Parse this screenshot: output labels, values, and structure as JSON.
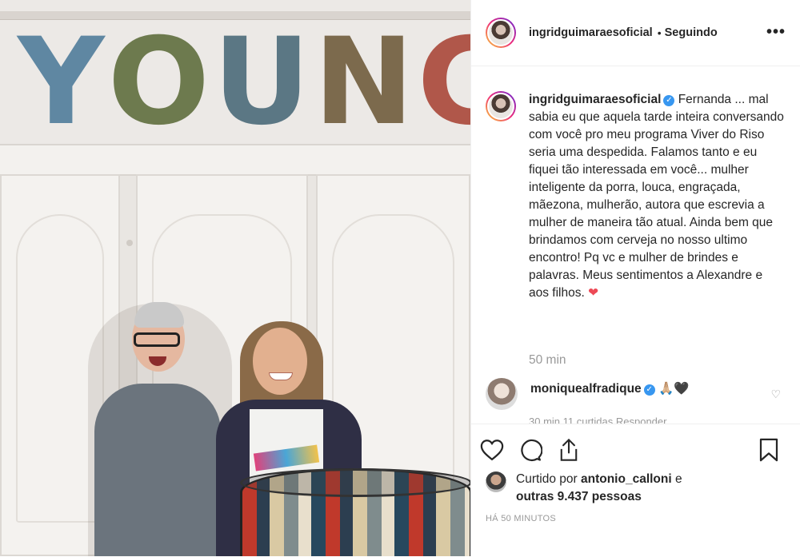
{
  "photo": {
    "letters": [
      "Y",
      "O",
      "U",
      "N",
      "G"
    ]
  },
  "header": {
    "username": "ingridguimaraesoficial",
    "separator": "•",
    "following_label": "Seguindo",
    "more_label": "•••"
  },
  "caption": {
    "username": "ingridguimaraesoficial",
    "text": "Fernanda ... mal sabia eu que aquela tarde inteira conversando com você pro meu programa Viver do Riso seria uma despedida. Falamos tanto e eu fiquei tão interessada em você... mulher inteligente da porra, louca, engraçada, mãezona, mulherão, autora que escrevia a mulher de maneira tão atual. Ainda bem que brindamos com cerveja no nosso ultimo encontro! Pq vc e mulher de brindes e palavras. Meus sentimentos a Alexandre e aos filhos.",
    "emoji": "❤",
    "time": "50 min"
  },
  "comment": {
    "username": "moniquealfradique",
    "emojis": "🙏🏼🖤",
    "cut_text": "30 min    11 curtidas    Responder"
  },
  "likes": {
    "prefix": "Curtido por",
    "user": "antonio_calloni",
    "connector": "e",
    "others": "outras 9.437 pessoas"
  },
  "timestamp": "HÁ 50 MINUTOS",
  "colors": {
    "verified": "#3897f0",
    "heart": "#ed4956",
    "muted": "#999999"
  }
}
